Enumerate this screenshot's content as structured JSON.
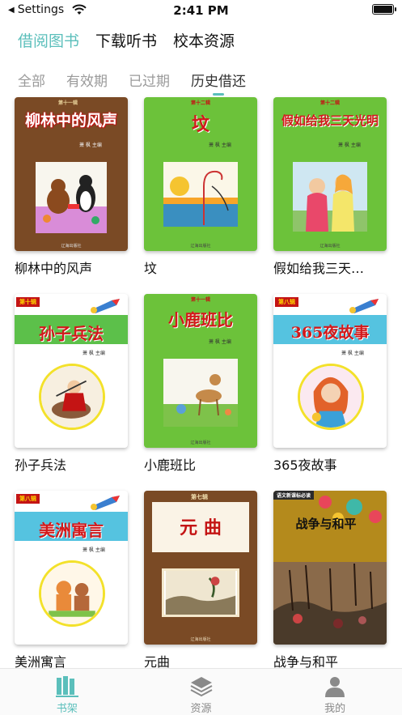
{
  "status_bar": {
    "back_label": "Settings",
    "time": "2:41 PM"
  },
  "main_tabs": [
    {
      "label": "借阅图书",
      "active": true
    },
    {
      "label": "下载听书",
      "active": false
    },
    {
      "label": "校本资源",
      "active": false
    }
  ],
  "sub_tabs": [
    {
      "label": "全部",
      "active": false
    },
    {
      "label": "有效期",
      "active": false
    },
    {
      "label": "已过期",
      "active": false
    },
    {
      "label": "历史借还",
      "active": true
    }
  ],
  "books": [
    {
      "title": "柳林中的风声",
      "cover_title": "柳林中的风声",
      "cover_series": "第十一辑",
      "cover_author": "萧 枫 主编",
      "cover_publisher": "辽海出版社"
    },
    {
      "title": "坟",
      "cover_title": "坟",
      "cover_series": "第十二辑",
      "cover_author": "萧 枫 主编",
      "cover_publisher": "辽海出版社"
    },
    {
      "title": "假如给我三天…",
      "cover_title": "假如给我三天光明",
      "cover_series": "第十二辑",
      "cover_author": "萧 枫 主编",
      "cover_publisher": "辽海出版社"
    },
    {
      "title": "孙子兵法",
      "cover_title": "孙子兵法",
      "cover_series": "第十辑",
      "cover_author": "萧 枫 主编",
      "cover_publisher": ""
    },
    {
      "title": "小鹿班比",
      "cover_title": "小鹿班比",
      "cover_series": "第十一辑",
      "cover_author": "萧 枫 主编",
      "cover_publisher": "辽海出版社"
    },
    {
      "title": "365夜故事",
      "cover_title": "365夜故事",
      "cover_series": "第八辑",
      "cover_author": "萧 枫 主编",
      "cover_publisher": ""
    },
    {
      "title": "美洲寓言",
      "cover_title": "美洲寓言",
      "cover_series": "第八辑",
      "cover_author": "萧 枫 主编",
      "cover_publisher": ""
    },
    {
      "title": "元曲",
      "cover_title": "元 曲",
      "cover_series": "第七辑",
      "cover_author": "",
      "cover_publisher": "辽海出版社"
    },
    {
      "title": "战争与和平",
      "cover_title": "战争与和平",
      "cover_series": "语文新课标必读",
      "cover_author": "",
      "cover_publisher": ""
    }
  ],
  "tabbar": [
    {
      "label": "书架",
      "icon": "bookshelf-icon",
      "active": true
    },
    {
      "label": "资源",
      "icon": "layers-icon",
      "active": false
    },
    {
      "label": "我的",
      "icon": "person-icon",
      "active": false
    }
  ],
  "colors": {
    "accent": "#5bbfbb",
    "brown_cover": "#7a4a25",
    "green_cover": "#6cc23a",
    "title_red": "#d2191b"
  }
}
